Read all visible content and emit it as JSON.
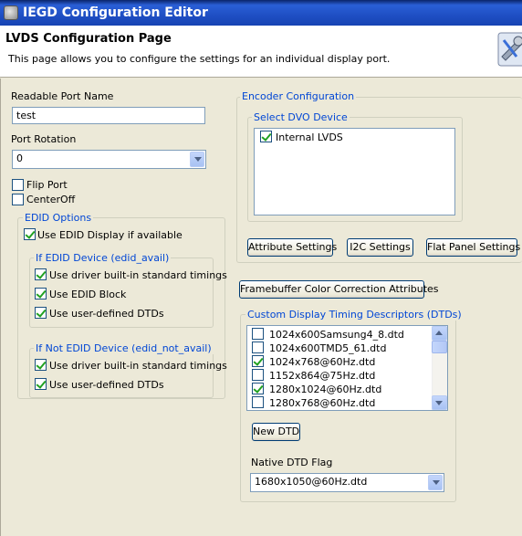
{
  "window": {
    "title": "IEGD Configuration Editor"
  },
  "header": {
    "page_title": "LVDS Configuration Page",
    "description": "This page allows you to configure the settings for an individual display port."
  },
  "left": {
    "port_name_label": "Readable Port Name",
    "port_name_value": "test",
    "rotation_label": "Port Rotation",
    "rotation_value": "0",
    "flip_port_label": "Flip Port",
    "flip_port_checked": false,
    "center_off_label": "CenterOff",
    "center_off_checked": false,
    "edid_options": {
      "title": "EDID Options",
      "use_edid_label": "Use EDID Display if available",
      "use_edid_checked": true,
      "if_edid": {
        "title": "If EDID Device (edid_avail)",
        "items": [
          {
            "label": "Use driver built-in standard timings",
            "checked": true
          },
          {
            "label": "Use EDID Block",
            "checked": true
          },
          {
            "label": "Use user-defined DTDs",
            "checked": true
          }
        ]
      },
      "if_not_edid": {
        "title": "If Not EDID Device (edid_not_avail)",
        "items": [
          {
            "label": "Use driver built-in standard timings",
            "checked": true
          },
          {
            "label": "Use user-defined DTDs",
            "checked": true
          }
        ]
      }
    }
  },
  "right": {
    "encoder": {
      "title": "Encoder Configuration",
      "dvo_group_title": "Select DVO Device",
      "dvo_items": [
        {
          "label": "Internal LVDS",
          "checked": true
        }
      ],
      "attribute_button": "Attribute Settings",
      "i2c_button": "I2C Settings",
      "flat_panel_button": "Flat Panel Settings"
    },
    "framebuffer_button": "Framebuffer Color Correction Attributes",
    "dtd": {
      "title": "Custom Display Timing Descriptors (DTDs)",
      "items": [
        {
          "label": "1024x600Samsung4_8.dtd",
          "checked": false
        },
        {
          "label": "1024x600TMD5_61.dtd",
          "checked": false
        },
        {
          "label": "1024x768@60Hz.dtd",
          "checked": true
        },
        {
          "label": "1152x864@75Hz.dtd",
          "checked": false
        },
        {
          "label": "1280x1024@60Hz.dtd",
          "checked": true
        },
        {
          "label": "1280x768@60Hz.dtd",
          "checked": false
        }
      ],
      "new_dtd_button": "New DTD",
      "native_flag_label": "Native DTD Flag",
      "native_flag_value": "1680x1050@60Hz.dtd"
    }
  }
}
